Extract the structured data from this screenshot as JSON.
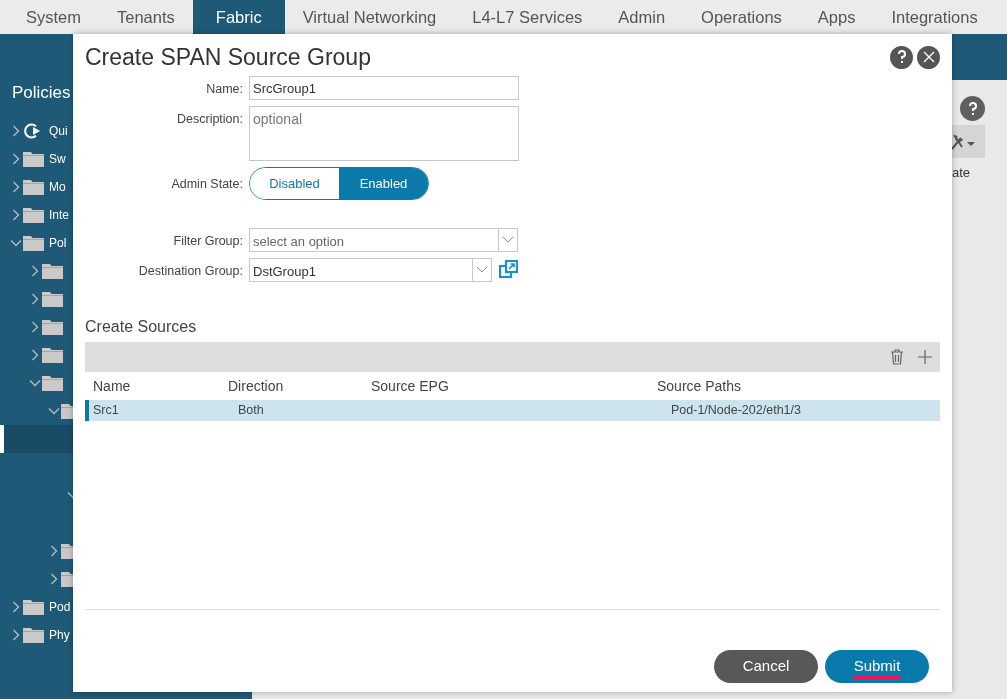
{
  "top_tabs": [
    {
      "label": "System",
      "selected": false
    },
    {
      "label": "Tenants",
      "selected": false
    },
    {
      "label": "Fabric",
      "selected": true
    },
    {
      "label": "Virtual Networking",
      "selected": false
    },
    {
      "label": "L4-L7 Services",
      "selected": false
    },
    {
      "label": "Admin",
      "selected": false
    },
    {
      "label": "Operations",
      "selected": false
    },
    {
      "label": "Apps",
      "selected": false
    },
    {
      "label": "Integrations",
      "selected": false
    }
  ],
  "sidebar": {
    "title": "Policies",
    "tree": [
      {
        "label": "Qui",
        "kind": "quickstart",
        "expanded": false,
        "selected": false
      },
      {
        "label": "Sw",
        "kind": "folder",
        "expanded": false,
        "selected": false
      },
      {
        "label": "Mo",
        "kind": "folder",
        "expanded": false,
        "selected": false
      },
      {
        "label": "Inte",
        "kind": "folder",
        "expanded": false,
        "selected": false
      },
      {
        "label": "Pol",
        "kind": "folder",
        "expanded": true,
        "selected": false,
        "children": [
          {
            "kind": "folder",
            "expanded": false,
            "selected": false
          },
          {
            "kind": "folder",
            "expanded": false,
            "selected": false
          },
          {
            "kind": "folder",
            "expanded": false,
            "selected": false
          },
          {
            "kind": "folder",
            "expanded": false,
            "selected": false
          },
          {
            "kind": "folder",
            "expanded": true,
            "selected": false,
            "children": [
              {
                "kind": "folder",
                "expanded": true,
                "selected": false,
                "children": [
                  {
                    "selected": true
                  },
                  {
                    "selected": false
                  },
                  {
                    "expanded": true,
                    "selected": false,
                    "children": [
                      {
                        "selected": false
                      }
                    ]
                  }
                ]
              },
              {
                "kind": "folder",
                "expanded": false,
                "selected": false
              },
              {
                "kind": "folder",
                "expanded": false,
                "selected": false
              }
            ]
          }
        ]
      },
      {
        "label": "Pod",
        "kind": "folder",
        "expanded": false,
        "selected": false
      },
      {
        "label": "Phy",
        "kind": "folder",
        "expanded": false,
        "selected": false
      }
    ]
  },
  "background_panel": {
    "column_text": "ate"
  },
  "dialog": {
    "title": "Create SPAN Source Group",
    "fields": [
      {
        "kind": "text",
        "label": "Name:",
        "value": "SrcGroup1"
      },
      {
        "kind": "textarea",
        "label": "Description:",
        "placeholder": "optional"
      },
      {
        "kind": "toggle",
        "label": "Admin State:",
        "options": [
          {
            "label": "Disabled",
            "selected": false
          },
          {
            "label": "Enabled",
            "selected": true
          }
        ]
      },
      {
        "kind": "select",
        "label": "Filter Group:",
        "placeholder": "select an option",
        "has_link": false
      },
      {
        "kind": "select",
        "label": "Destination Group:",
        "value": "DstGroup1",
        "has_link": true
      }
    ],
    "sources": {
      "title": "Create Sources",
      "columns": [
        "Name",
        "Direction",
        "Source EPG",
        "Source Paths"
      ],
      "rows": [
        {
          "cells": [
            "Src1",
            "Both",
            "",
            "Pod-1/Node-202/eth1/3"
          ],
          "selected": true
        }
      ]
    },
    "buttons": [
      {
        "label": "Cancel",
        "kind": "secondary",
        "underlined": false
      },
      {
        "label": "Submit",
        "kind": "primary",
        "underlined": true
      }
    ]
  }
}
